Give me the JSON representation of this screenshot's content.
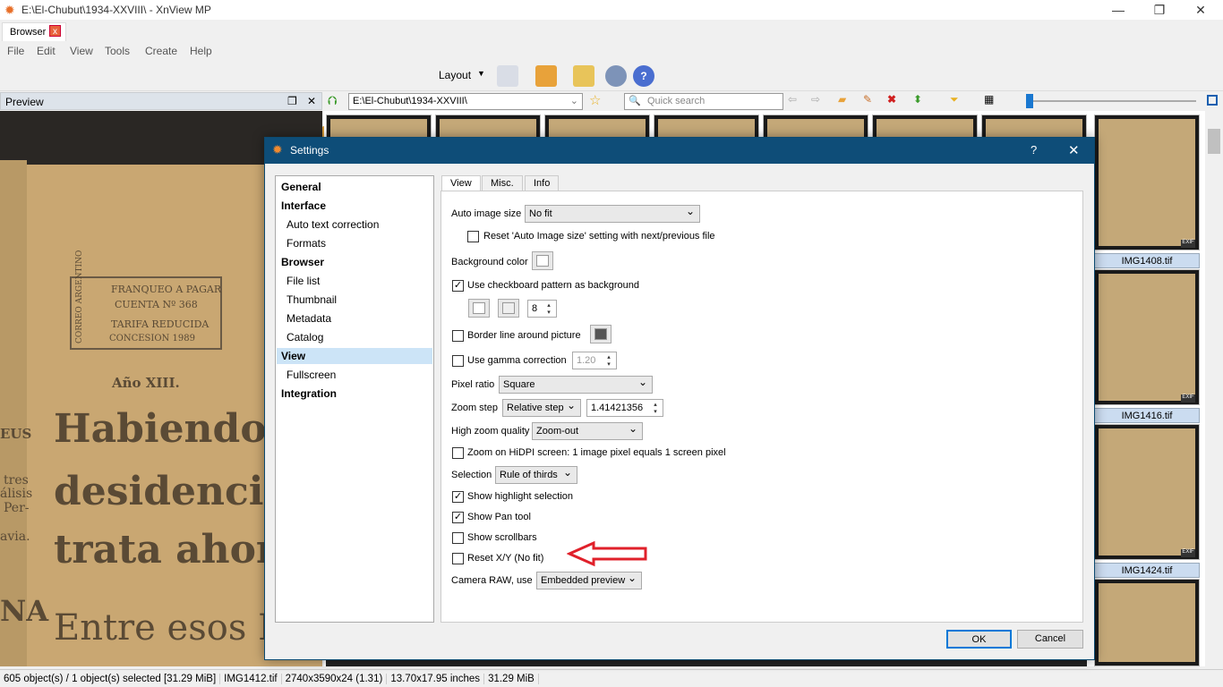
{
  "window": {
    "title": "E:\\El-Chubut\\1934-XXVIII\\ - XnView MP",
    "minimize": "—",
    "maximize": "❐",
    "close": "✕"
  },
  "tabs": [
    {
      "label": "Browser",
      "close": "x"
    }
  ],
  "menu": [
    "File",
    "Edit",
    "View",
    "Tools",
    "Create",
    "Help"
  ],
  "toolbar": {
    "layout_label": "Layout"
  },
  "preview": {
    "title": "Preview",
    "newspaper_text": [
      "FRANQUEO A PAGAR",
      "CUENTA Nº 368",
      "TARIFA REDUCIDA",
      "CONCESION 1989",
      "CORREO ARGENTINO",
      "Año XIII.",
      "Habiendose",
      "desidencias",
      "trata ahora",
      "Entre esos F",
      "EUS",
      "tres",
      "álisis",
      "Per-",
      "avia.",
      "NA"
    ]
  },
  "browser": {
    "path": "E:\\El-Chubut\\1934-XXVIII\\",
    "search_placeholder": "Quick search",
    "thumbnails": [
      "IMG1408.tif",
      "IMG1416.tif",
      "IMG1424.tif"
    ],
    "exif_badge": "EXIF"
  },
  "status": [
    "605 object(s) / 1 object(s) selected [31.29 MiB]",
    "IMG1412.tif",
    "2740x3590x24 (1.31)",
    "13.70x17.95 inches",
    "31.29 MiB"
  ],
  "dialog": {
    "title": "Settings",
    "help": "?",
    "close": "✕",
    "nav": [
      {
        "label": "General",
        "bold": true
      },
      {
        "label": "Interface",
        "bold": true
      },
      {
        "label": "Auto text correction"
      },
      {
        "label": "Formats"
      },
      {
        "label": "Browser",
        "bold": true
      },
      {
        "label": "File list"
      },
      {
        "label": "Thumbnail"
      },
      {
        "label": "Metadata"
      },
      {
        "label": "Catalog"
      },
      {
        "label": "View",
        "bold": true,
        "selected": true
      },
      {
        "label": "Fullscreen"
      },
      {
        "label": "Integration",
        "bold": true
      }
    ],
    "tabs": [
      "View",
      "Misc.",
      "Info"
    ],
    "view": {
      "auto_image_size_label": "Auto image size",
      "auto_image_size": "No fit",
      "reset_auto": "Reset 'Auto Image size' setting with next/previous file",
      "bg_color_label": "Background color",
      "checkboard": "Use checkboard pattern as background",
      "checkboard_size": "8",
      "border_line": "Border line around picture",
      "gamma": "Use gamma correction",
      "gamma_value": "1.20",
      "pixel_ratio_label": "Pixel ratio",
      "pixel_ratio": "Square",
      "zoom_step_label": "Zoom step",
      "zoom_step": "Relative step",
      "zoom_step_value": "1.41421356",
      "hq_label": "High zoom quality",
      "hq": "Zoom-out",
      "hidpi": "Zoom on HiDPI screen: 1 image pixel equals 1 screen pixel",
      "selection_label": "Selection",
      "selection": "Rule of thirds",
      "highlight": "Show highlight selection",
      "pan": "Show Pan tool",
      "scrollbars": "Show scrollbars",
      "reset_xy": "Reset X/Y (No fit)",
      "raw_label": "Camera RAW, use",
      "raw": "Embedded preview"
    },
    "ok": "OK",
    "cancel": "Cancel"
  },
  "colors": {
    "dialog_title": "#0e4d78",
    "annotation_arrow": "#e0202a",
    "selection": "#cce4f7"
  }
}
